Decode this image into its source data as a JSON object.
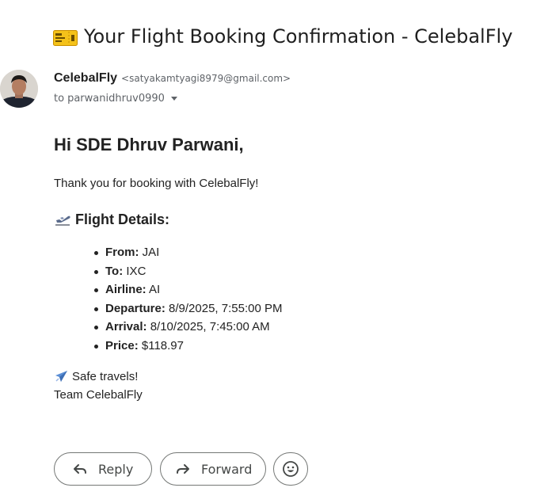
{
  "email": {
    "subject": "Your Flight Booking Confirmation - CelebalFly",
    "subject_icon": "ticket-icon",
    "sender": {
      "name": "CelebalFly",
      "email": "<satyakamtyagi8979@gmail.com>"
    },
    "recipient": {
      "label": "to",
      "name": "parwanidhruv0990"
    },
    "body": {
      "greeting": "Hi SDE Dhruv Parwani,",
      "thanks": "Thank you for booking with CelebalFly!",
      "details_heading": "Flight Details:",
      "details_heading_icon": "airplane-departure-icon",
      "details": [
        {
          "label": "From:",
          "value": "JAI"
        },
        {
          "label": "To:",
          "value": "IXC"
        },
        {
          "label": "Airline:",
          "value": "AI"
        },
        {
          "label": "Departure:",
          "value": "8/9/2025, 7:55:00 PM"
        },
        {
          "label": "Arrival:",
          "value": "8/10/2025, 7:45:00 AM"
        },
        {
          "label": "Price:",
          "value": "$118.97"
        }
      ],
      "closing": "Safe travels!",
      "closing_icon": "airplane-icon",
      "signature": "Team CelebalFly"
    }
  },
  "actions": {
    "reply_label": "Reply",
    "forward_label": "Forward",
    "emoji_icon": "smiley-icon"
  },
  "colors": {
    "text": "#222222",
    "muted": "#5f6368",
    "button_border": "#747775",
    "ticket_yellow": "#f4c21a"
  }
}
